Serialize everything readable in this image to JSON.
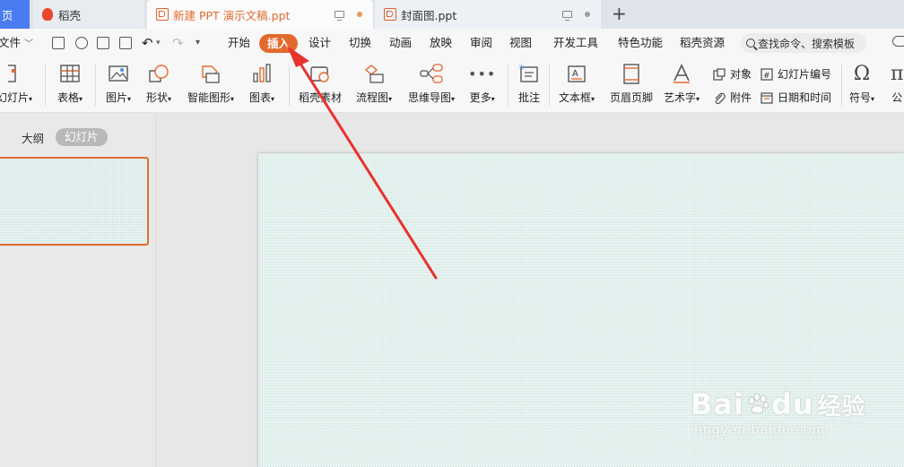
{
  "tabs": {
    "home": "页",
    "wps": "稻壳",
    "active_doc": "新建 PPT 演示文稿.ppt",
    "second_doc": "封面图.ppt"
  },
  "menu": {
    "file": "文件",
    "items": [
      "开始",
      "插入",
      "设计",
      "切换",
      "动画",
      "放映",
      "审阅",
      "视图",
      "开发工具",
      "特色功能",
      "稻壳资源"
    ],
    "active": "插入",
    "search_placeholder": "查找命令、搜索模板"
  },
  "ribbon": {
    "slide": "幻灯片",
    "table": "表格",
    "picture": "图片",
    "shape": "形状",
    "smartart": "智能图形",
    "chart": "图表",
    "docer_material": "稻壳素材",
    "flowchart": "流程图",
    "mindmap": "思维导图",
    "more": "更多",
    "comment": "批注",
    "textbox": "文本框",
    "header_footer": "页眉页脚",
    "wordart": "艺术字",
    "object": "对象",
    "attachment": "附件",
    "slide_number": "幻灯片编号",
    "date_time": "日期和时间",
    "symbol": "符号",
    "formula": "公"
  },
  "left_panel": {
    "outline_tab": "大纲",
    "slides_tab": "幻灯片"
  },
  "watermark": {
    "brand_a": "Bai",
    "brand_b": "du",
    "brand_cn": "经验",
    "url": "jingyan.baidu.com"
  },
  "colors": {
    "accent": "#e36a2e",
    "arrow": "#e8322e",
    "home_tab": "#4a7cf0"
  }
}
